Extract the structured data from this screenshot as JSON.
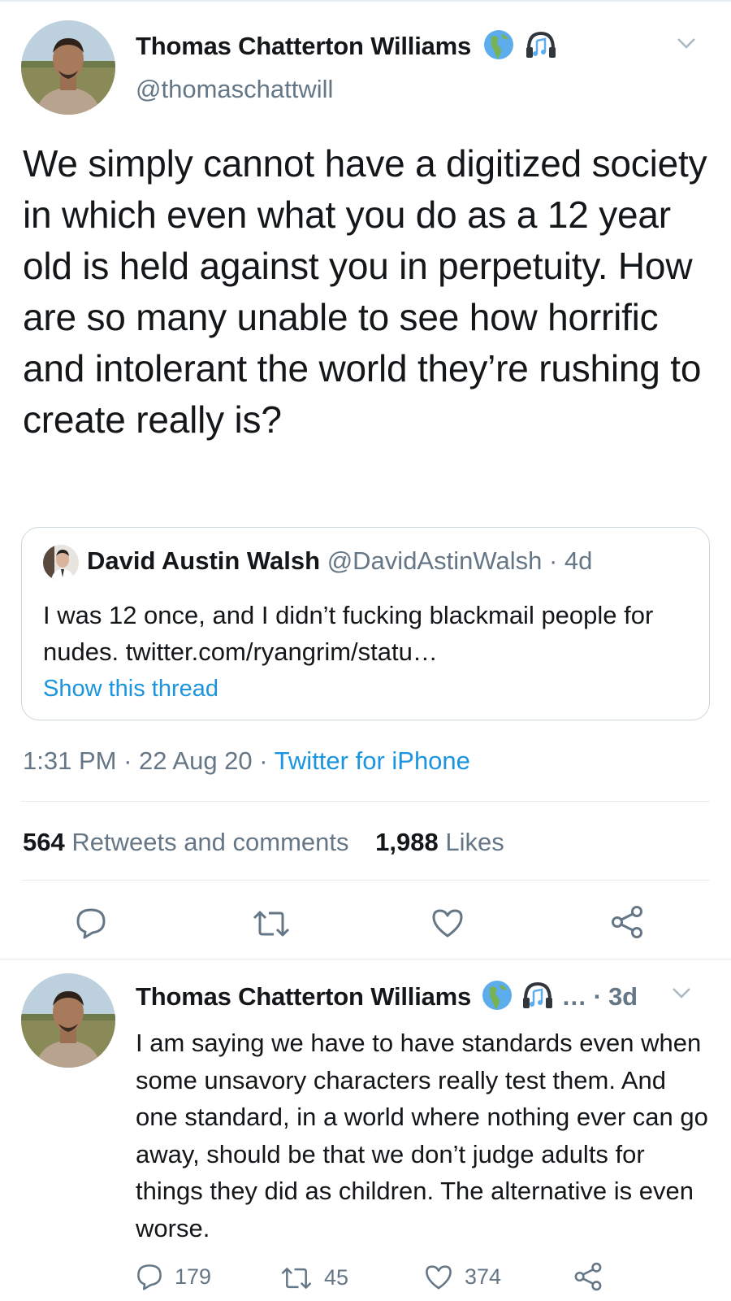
{
  "main_tweet": {
    "author_name": "Thomas Chatterton Williams",
    "author_handle": "@thomaschattwill",
    "badges": [
      "earth-africa-emoji",
      "headphones-music-emoji"
    ],
    "text": "We simply cannot have a digitized society in which even what you do as a 12 year old is held against you in perpetuity. How are so many unable to see how horrific and intolerant the world they’re rushing to create really is?",
    "quoted": {
      "author_name": "David Austin Walsh",
      "author_handle": "@DavidAstinWalsh",
      "separator": "·",
      "age": "4d",
      "text": "I was 12 once, and I didn’t fucking blackmail people for nudes. twitter.com/ryangrim/statu…",
      "link_label": "Show this thread"
    },
    "time": "1:31 PM",
    "date": "22 Aug 20",
    "source": "Twitter for iPhone",
    "sep": "·",
    "retweets_count": "564",
    "retweets_label": "Retweets and comments",
    "likes_count": "1,988",
    "likes_label": "Likes",
    "action_icons": [
      "reply-icon",
      "retweet-icon",
      "like-icon",
      "share-icon"
    ]
  },
  "reply_tweet": {
    "author_name": "Thomas Chatterton Williams",
    "ellipsis": "…",
    "separator": "·",
    "age": "3d",
    "text": "I am saying we have to have standards even when some unsavory characters really test them. And one standard, in a world where nothing ever can go away, should be that we don’t judge adults for things they did as children. The alternative is even worse.",
    "reply_count": "179",
    "retweet_count": "45",
    "like_count": "374"
  },
  "colors": {
    "text": "#14171a",
    "secondary": "#657786",
    "link": "#1b95e0",
    "border": "#e6ecf0"
  }
}
